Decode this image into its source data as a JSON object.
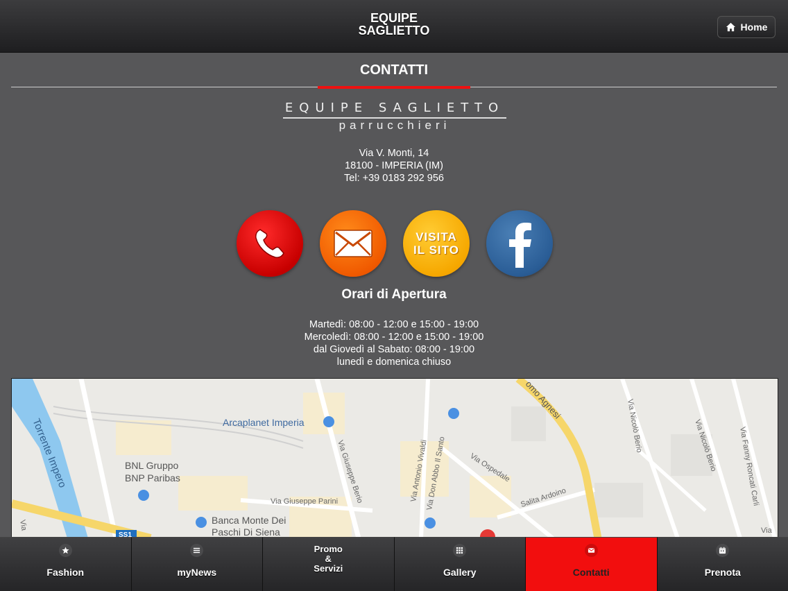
{
  "header": {
    "title_line1": "EQUIPE",
    "title_line2": "SAGLIETTO",
    "home_label": "Home"
  },
  "section": {
    "title": "CONTATTI"
  },
  "logo": {
    "name": "EQUIPE SAGLIETTO",
    "subtitle": "parrucchieri"
  },
  "address": {
    "street": "Via V. Monti, 14",
    "city": "18100 - IMPERIA (IM)",
    "phone": "Tel: +39 0183 292 956"
  },
  "actions": {
    "visit_site_line1": "VISITA",
    "visit_site_line2": "IL SITO"
  },
  "hours": {
    "title": "Orari di Apertura",
    "lines": [
      "Martedì: 08:00 - 12:00 e 15:00 - 19:00",
      "Mercoledì: 08:00 - 12:00 e 15:00 - 19:00",
      "dal Giovedì al Sabato: 08:00 - 19:00",
      "lunedì e domenica chiuso"
    ]
  },
  "map": {
    "labels": {
      "torrente": "Torrente Impero",
      "arcaplanet": "Arcaplanet Imperia",
      "bnl_1": "BNL Gruppo",
      "bnl_2": "BNP Paribas",
      "banca_1": "Banca Monte Dei",
      "banca_2": "Paschi Di Siena",
      "parini": "Via Giuseppe Parini",
      "berio_g": "Via Giuseppe Berio",
      "vivaldi": "Via Antonio Vivaldi",
      "don_abbo": "Via Don Abbo Il Santo",
      "ospedale": "Via Ospedale",
      "ardoino": "Salita Ardoino",
      "agnesi": "omo Agnesi",
      "nicolo_berio_1": "Via Nicolò Berio",
      "nicolo_berio_2": "Via Nicolò Berio",
      "fanny": "Via Fanny Roncati Carli",
      "ss1": "SS1",
      "via_left": "Via",
      "via_right": "Via"
    }
  },
  "nav": {
    "fashion": "Fashion",
    "mynews": "myNews",
    "promo_1": "Promo",
    "promo_2": "&",
    "promo_3": "Servizi",
    "gallery": "Gallery",
    "contatti": "Contatti",
    "prenota": "Prenota"
  },
  "colors": {
    "background": "#575759",
    "accent": "#f20e0e",
    "phone": "#e00000",
    "mail": "#f26a00",
    "site": "#f6aa00",
    "facebook": "#2a5d96"
  }
}
